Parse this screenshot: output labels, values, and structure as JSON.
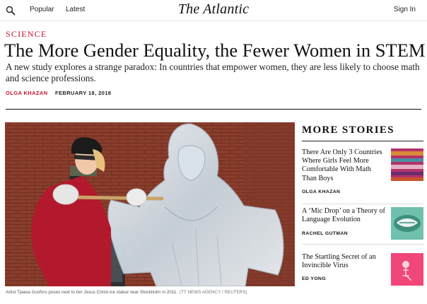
{
  "nav": {
    "popular": "Popular",
    "latest": "Latest",
    "logo": "The Atlantic",
    "signin": "Sign In"
  },
  "article": {
    "section": "Science",
    "headline": "The More Gender Equality, the Fewer Women in STEM",
    "dek": "A new study explores a strange paradox: In countries that empower women, they are less likely to choose math and science professions.",
    "author": "Olga Khazan",
    "date": "February 18, 2018",
    "caption": "Artist Tjaasa Gusfors poses next to her Jesus Christ ice statue near Stockholm in 2011.",
    "caption_credit": "(TT NEWS AGENCY / REUTERS)"
  },
  "more_stories": {
    "heading": "More Stories",
    "items": [
      {
        "title": "There Are Only 3 Countries Where Girls Feel More Comfortable With Math Than Boys",
        "author": "Olga Khazan",
        "thumb_color": "#b3326a"
      },
      {
        "title": "A ‘Mic Drop’ on a Theory of Language Evolution",
        "author": "Rachel Gutman",
        "thumb_color": "#6fc1ad"
      },
      {
        "title": "The Startling Secret of an Invincible Virus",
        "author": "Ed Yong",
        "thumb_color": "#f0467a"
      }
    ]
  },
  "colors": {
    "accent": "#c8102e",
    "text": "#111111"
  },
  "icons": {
    "search": "search-icon"
  }
}
